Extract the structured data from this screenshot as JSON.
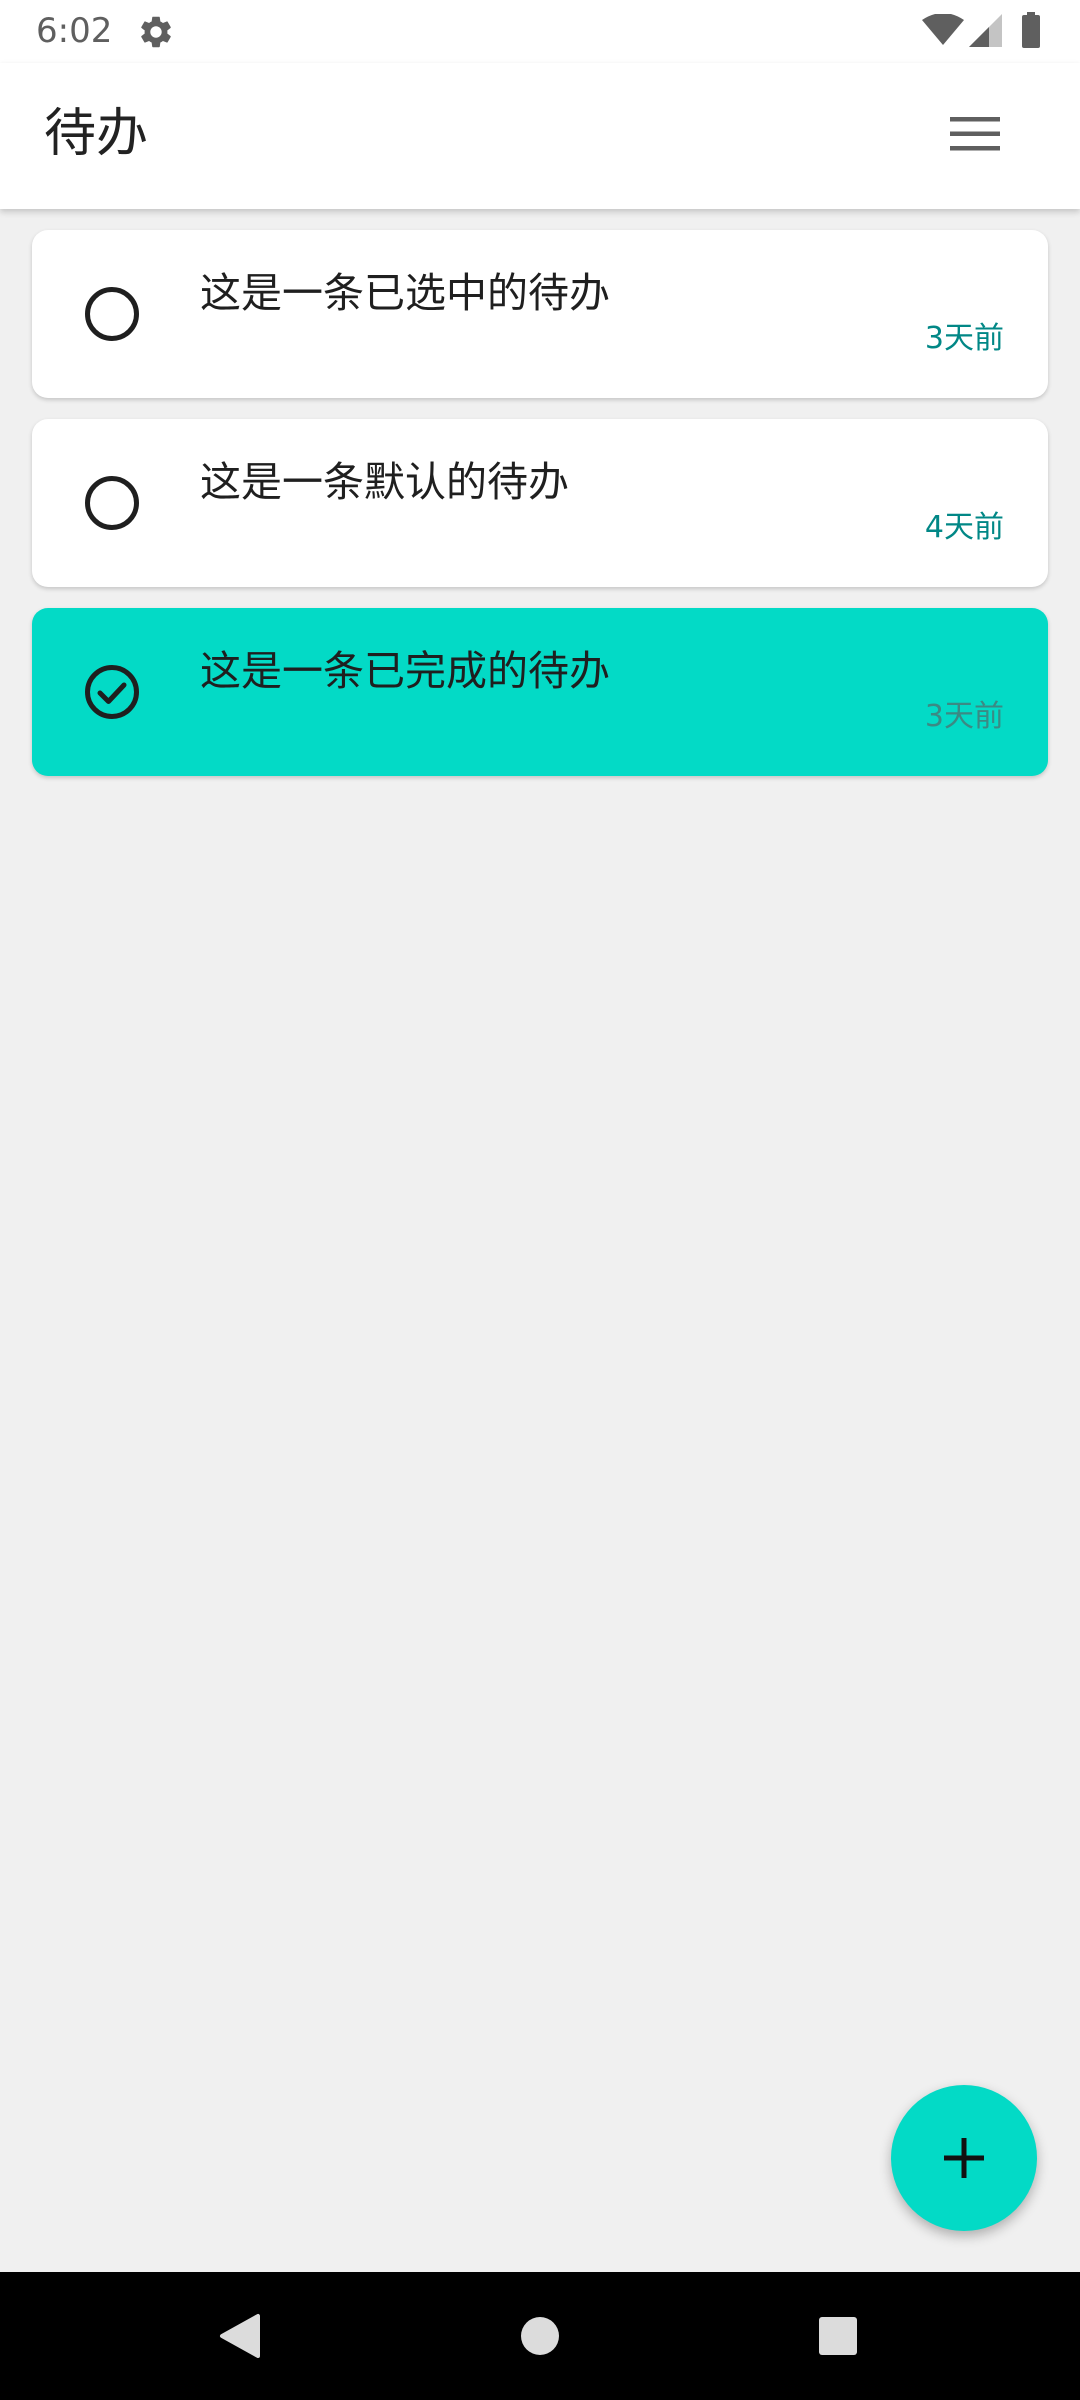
{
  "status_bar": {
    "time": "6:02",
    "icons": [
      "gear-icon",
      "wifi-icon",
      "signal-icon",
      "battery-icon"
    ]
  },
  "app_bar": {
    "title": "待办",
    "menu_icon": "hamburger-menu-icon"
  },
  "todos": [
    {
      "title": "这是一条已选中的待办",
      "time": "3天前",
      "done": false
    },
    {
      "title": "这是一条默认的待办",
      "time": "4天前",
      "done": false
    },
    {
      "title": "这是一条已完成的待办",
      "time": "3天前",
      "done": true
    }
  ],
  "fab": {
    "icon": "plus-icon"
  },
  "nav_bar": {
    "icons": [
      "back-icon",
      "home-icon",
      "recents-icon"
    ]
  },
  "colors": {
    "accent": "#03dac6",
    "timestamp": "#018786",
    "background": "#f0f0f0"
  }
}
